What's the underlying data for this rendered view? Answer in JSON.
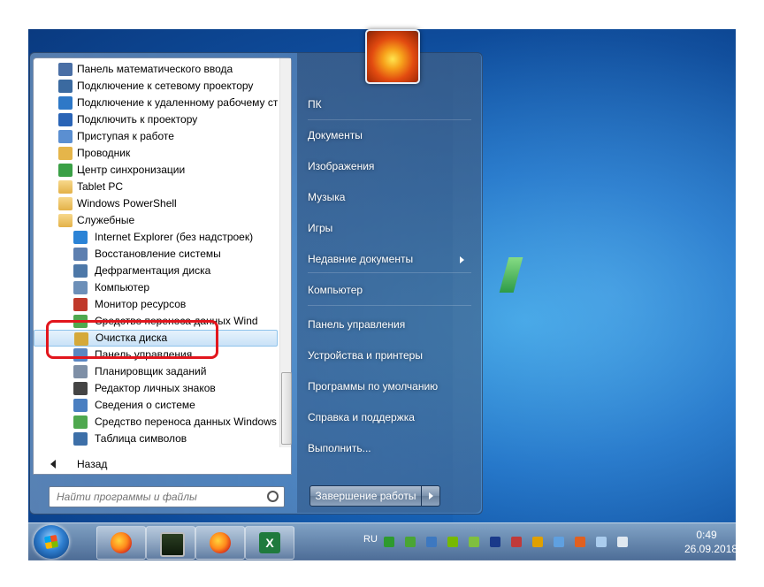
{
  "start_menu": {
    "programs": [
      {
        "label": "Панель математического ввода",
        "level": 0,
        "icon": "math-input-icon",
        "color": "#4a6fa5"
      },
      {
        "label": "Подключение к сетевому проектору",
        "level": 0,
        "icon": "network-projector-icon",
        "color": "#3b6aa0"
      },
      {
        "label": "Подключение к удаленному рабочему столу",
        "level": 0,
        "icon": "remote-desktop-icon",
        "color": "#2e78c7"
      },
      {
        "label": "Подключить к проектору",
        "level": 0,
        "icon": "projector-icon",
        "color": "#2a64b6"
      },
      {
        "label": "Приступая к работе",
        "level": 0,
        "icon": "getting-started-icon",
        "color": "#5b8fd1"
      },
      {
        "label": "Проводник",
        "level": 0,
        "icon": "explorer-folder-icon",
        "color": "#e5b54a"
      },
      {
        "label": "Центр синхронизации",
        "level": 0,
        "icon": "sync-center-icon",
        "color": "#3aa046"
      },
      {
        "label": "Tablet PC",
        "level": 0,
        "icon": "folder-icon",
        "color": "#e3b148"
      },
      {
        "label": "Windows PowerShell",
        "level": 0,
        "icon": "folder-icon",
        "color": "#e3b148"
      },
      {
        "label": "Служебные",
        "level": 0,
        "icon": "folder-icon",
        "color": "#e3b148"
      },
      {
        "label": "Internet Explorer (без надстроек)",
        "level": 1,
        "icon": "ie-icon",
        "color": "#2b83d6"
      },
      {
        "label": "Восстановление системы",
        "level": 1,
        "icon": "system-restore-icon",
        "color": "#5d7fb0"
      },
      {
        "label": "Дефрагментация диска",
        "level": 1,
        "icon": "defrag-icon",
        "color": "#4d78a8"
      },
      {
        "label": "Компьютер",
        "level": 1,
        "icon": "computer-icon",
        "color": "#6c8fb8"
      },
      {
        "label": "Монитор ресурсов",
        "level": 1,
        "icon": "resource-monitor-icon",
        "color": "#c0392b"
      },
      {
        "label": "Средство переноса данных Wind",
        "level": 1,
        "icon": "transfer-icon",
        "color": "#4fa84f"
      },
      {
        "label": "Очистка диска",
        "level": 1,
        "icon": "disk-cleanup-icon",
        "color": "#d5a93a",
        "selected": true
      },
      {
        "label": "Панель управления",
        "level": 1,
        "icon": "control-panel-icon",
        "color": "#5a86c2"
      },
      {
        "label": "Планировщик заданий",
        "level": 1,
        "icon": "task-scheduler-icon",
        "color": "#7e8fa6"
      },
      {
        "label": "Редактор личных знаков",
        "level": 1,
        "icon": "char-editor-icon",
        "color": "#444444"
      },
      {
        "label": "Сведения о системе",
        "level": 1,
        "icon": "system-info-icon",
        "color": "#4a7fc1"
      },
      {
        "label": "Средство переноса данных Windows",
        "level": 1,
        "icon": "transfer-icon",
        "color": "#4fa84f"
      },
      {
        "label": "Таблица символов",
        "level": 1,
        "icon": "char-map-icon",
        "color": "#3d6fa8"
      }
    ],
    "back_label": "Назад",
    "search_placeholder": "Найти программы и файлы",
    "right_items": [
      {
        "label": "ПК",
        "name": "right-item-pc"
      },
      {
        "label": "Документы",
        "name": "right-item-documents"
      },
      {
        "label": "Изображения",
        "name": "right-item-pictures"
      },
      {
        "label": "Музыка",
        "name": "right-item-music"
      },
      {
        "label": "Игры",
        "name": "right-item-games"
      },
      {
        "label": "Недавние документы",
        "name": "right-item-recent-documents",
        "submenu": true
      },
      {
        "label": "Компьютер",
        "name": "right-item-computer"
      },
      {
        "label": "Панель управления",
        "name": "right-item-control-panel"
      },
      {
        "label": "Устройства и принтеры",
        "name": "right-item-devices-printers"
      },
      {
        "label": "Программы по умолчанию",
        "name": "right-item-default-programs"
      },
      {
        "label": "Справка и поддержка",
        "name": "right-item-help-support"
      },
      {
        "label": "Выполнить...",
        "name": "right-item-run"
      }
    ],
    "shutdown_label": "Завершение работы"
  },
  "taskbar": {
    "pinned": [
      {
        "name": "firefox-taskbar-button",
        "icon": "firefox-icon"
      },
      {
        "name": "system-monitor-taskbar-button",
        "icon": "monitor-icon"
      },
      {
        "name": "firefox-taskbar-button-2",
        "icon": "firefox-icon"
      },
      {
        "name": "excel-taskbar-button",
        "icon": "excel-icon",
        "text": "X"
      }
    ],
    "language": "RU",
    "clock_time": "0:49",
    "clock_date": "26.09.2018",
    "tray_icons": [
      {
        "name": "tray-green-icon",
        "color": "#2e9a2e"
      },
      {
        "name": "utorrent-icon",
        "color": "#4aa534"
      },
      {
        "name": "tray-gear-icon",
        "color": "#3d78c0"
      },
      {
        "name": "nvidia-icon",
        "color": "#76b900"
      },
      {
        "name": "tray-battery-icon",
        "color": "#7fbf3f"
      },
      {
        "name": "tray-save-icon",
        "color": "#1a3a8a"
      },
      {
        "name": "tray-tool-icon",
        "color": "#c03a3a"
      },
      {
        "name": "tray-alert-icon",
        "color": "#e0a000"
      },
      {
        "name": "tray-network-icon",
        "color": "#5fa0e0"
      },
      {
        "name": "tray-flag-icon",
        "color": "#e06020"
      },
      {
        "name": "tray-signal-icon",
        "color": "#aaccee"
      },
      {
        "name": "volume-icon",
        "color": "#e0e8f0"
      }
    ]
  }
}
